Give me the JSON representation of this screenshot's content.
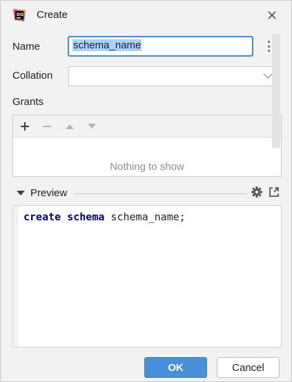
{
  "window": {
    "title": "Create"
  },
  "form": {
    "name_label": "Name",
    "name_value": "schema_name",
    "collation_label": "Collation",
    "collation_value": "",
    "grants_label": "Grants"
  },
  "grants": {
    "empty_text": "Nothing to show",
    "toolbar": {
      "add": "+",
      "remove": "−"
    }
  },
  "preview": {
    "label": "Preview",
    "code": {
      "kw1": "create",
      "kw2": "schema",
      "rest": " schema_name;"
    }
  },
  "buttons": {
    "ok": "OK",
    "cancel": "Cancel"
  },
  "colors": {
    "accent": "#4a8fd9",
    "keyword": "#00007f",
    "selection": "#a6d2ff"
  }
}
